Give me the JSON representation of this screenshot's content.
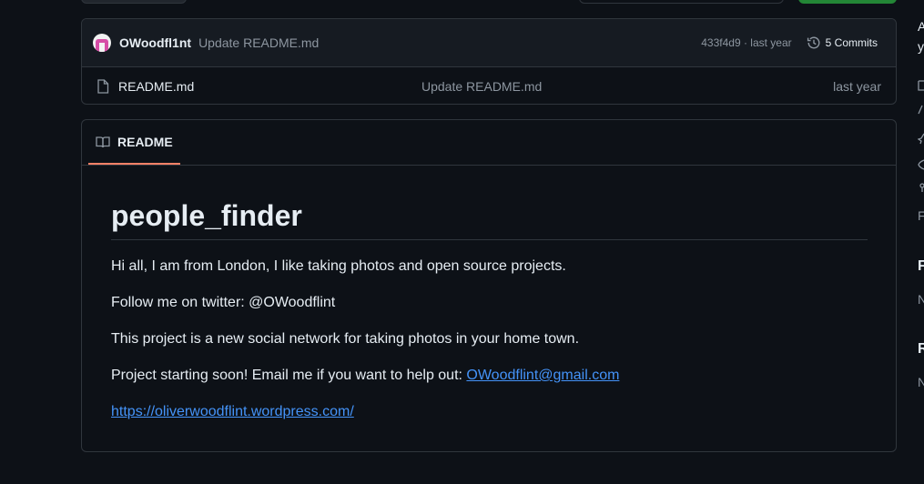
{
  "latest_commit": {
    "author": "OWoodfl1nt",
    "message": "Update README.md",
    "sha_age": "433f4d9 · last year",
    "commits_label": "5 Commits"
  },
  "files": [
    {
      "name": "README.md",
      "message": "Update README.md",
      "age": "last year"
    }
  ],
  "readme": {
    "tab_label": "README",
    "title": "people_finder",
    "para1": "Hi all, I am from London, I like taking photos and open source projects.",
    "para2": "Follow me on twitter: @OWoodflint",
    "para3": "This project is a new social network for taking photos in your home town.",
    "para4_text": "Project starting soon! Email me if you want to help out: ",
    "email": "OWoodflint@gmail.com",
    "website": "https://oliverwoodflint.wordpress.com/"
  },
  "sidebar_fragments": {
    "a1": "A",
    "a2": "y",
    "f1": "F",
    "f2": "F",
    "n1": "N",
    "r1": "R",
    "n2": "N"
  },
  "colors": {
    "accent_link": "#4493f8",
    "tab_underline": "#f78166",
    "green_button": "#238636"
  }
}
